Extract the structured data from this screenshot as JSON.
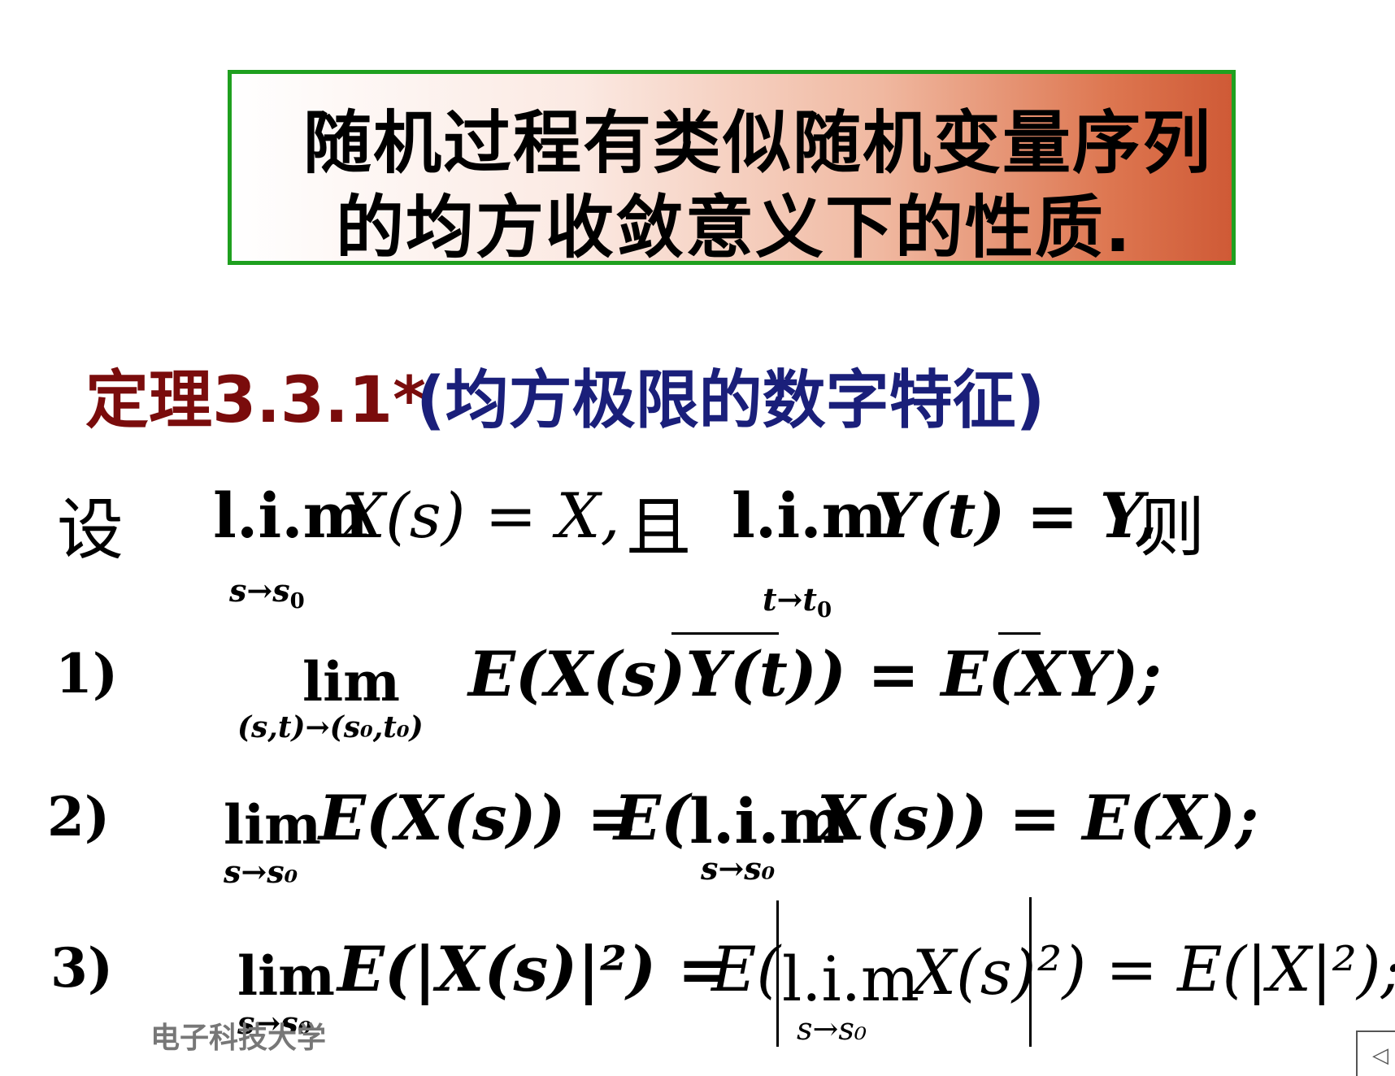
{
  "title_lines": [
    "随机过程有类似随机变量序列",
    "的均方收敛意义下的性质."
  ],
  "theorem": {
    "label": "定理3.3.1*",
    "desc": "(均方极限的数字特征)"
  },
  "given": {
    "she": "设",
    "lim1": "l.i.m",
    "expr1": "X(s) = X,",
    "qie": "且",
    "lim2": "l.i.m",
    "expr2": "Y(t) = Y,",
    "ze": "则",
    "sub1": "s→s",
    "sub1n": "0",
    "sub2": "t→t",
    "sub2n": "0"
  },
  "items": [
    {
      "num": "1)",
      "lim": "lim",
      "sub": "(s,t)→(s₀,t₀)",
      "lhs": "E(X(s)Y(t)) = E(XY);"
    },
    {
      "num": "2)",
      "lim": "lim",
      "sub": "s→s₀",
      "lhs": "E(X(s)) =",
      "mid_prefix": "E(",
      "mid_lim": "l.i.m",
      "mid_sub": "s→s₀",
      "rhs": "X(s)) = E(X);"
    },
    {
      "num": "3)",
      "lim": "lim",
      "sub": "s→s₀",
      "lhs": "E(|X(s)|²) =",
      "mid_prefix": "E(",
      "mid_lim": "l.i.m",
      "mid_sub": "s→s₀",
      "rhs_a": "X(s)",
      "rhs_b": "²) = E(|X|²);"
    }
  ],
  "footer": "电子科技大学",
  "colors": {
    "theorem_label": "#7a0c0c",
    "theorem_desc": "#1a1f7a",
    "border": "#1fa01f"
  }
}
